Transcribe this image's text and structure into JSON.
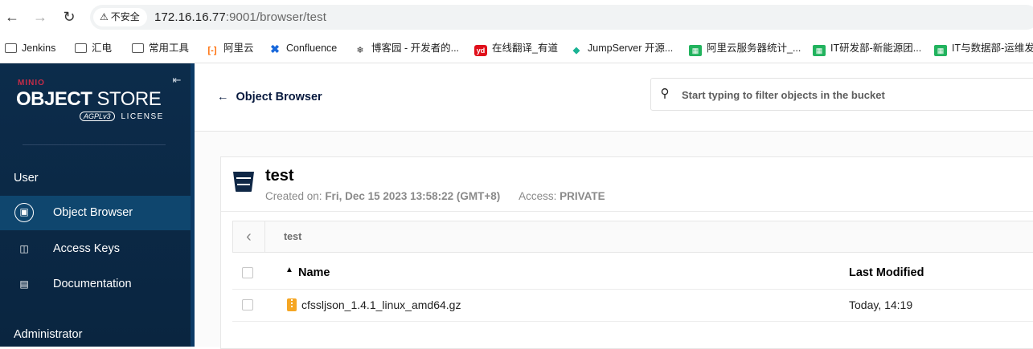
{
  "browser": {
    "security_label": "不安全",
    "url_host": "172.16.16.77",
    "url_rest": ":9001/browser/test",
    "bookmarks": [
      {
        "label": "Jenkins",
        "icon": "folder-icon"
      },
      {
        "label": "汇电",
        "icon": "folder-icon"
      },
      {
        "label": "常用工具",
        "icon": "folder-icon"
      },
      {
        "label": "阿里云",
        "icon": "aliyun-icon"
      },
      {
        "label": "Confluence",
        "icon": "confluence-icon"
      },
      {
        "label": "博客园 - 开发者的...",
        "icon": "cnblogs-icon"
      },
      {
        "label": "在线翻译_有道",
        "icon": "youdao-icon"
      },
      {
        "label": "JumpServer 开源...",
        "icon": "jumpserver-icon"
      },
      {
        "label": "阿里云服务器统计_...",
        "icon": "sheet-icon"
      },
      {
        "label": "IT研发部-新能源团...",
        "icon": "sheet-icon"
      },
      {
        "label": "IT与数据部-运维发",
        "icon": "sheet-icon"
      }
    ]
  },
  "sidebar": {
    "logo_brand": "MINIO",
    "logo_title_bold": "OBJECT",
    "logo_title_light": " STORE",
    "logo_badge": "AGPLv3",
    "logo_license": "LICENSE",
    "section_user": "User",
    "items": [
      {
        "label": "Object Browser",
        "icon": "object-browser-icon",
        "active": true
      },
      {
        "label": "Access Keys",
        "icon": "access-keys-icon",
        "active": false
      },
      {
        "label": "Documentation",
        "icon": "documentation-icon",
        "active": false
      }
    ],
    "section_admin": "Administrator"
  },
  "header": {
    "back_label": "Object Browser",
    "search_placeholder": "Start typing to filter objects in the bucket"
  },
  "bucket": {
    "name": "test",
    "created_label": "Created on:",
    "created_value": "Fri, Dec 15 2023 13:58:22 (GMT+8)",
    "access_label": "Access:",
    "access_value": "PRIVATE"
  },
  "breadcrumb": {
    "path": "test"
  },
  "table": {
    "columns": [
      "Name",
      "Last Modified"
    ],
    "rows": [
      {
        "name": "cfssljson_1.4.1_linux_amd64.gz",
        "modified": "Today, 14:19",
        "icon": "zip-file-icon"
      }
    ]
  },
  "colors": {
    "sidebar_bg": "#0c2c4b",
    "sidebar_active": "#0f466e",
    "brand_red": "#c72c48",
    "file_icon": "#f5a623"
  }
}
